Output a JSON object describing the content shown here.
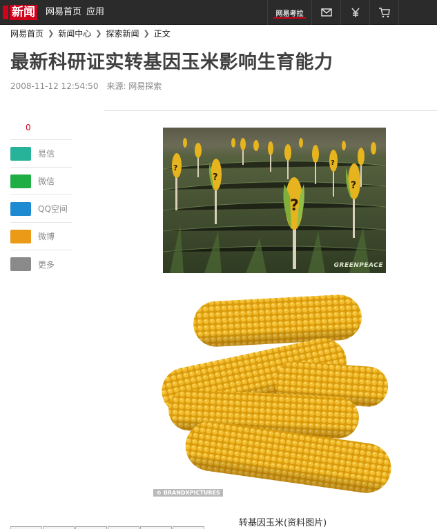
{
  "topbar": {
    "logo_text": "新闻",
    "nav": {
      "home": "网易首页",
      "apps": "应用"
    },
    "kaola": "网易考拉",
    "icons": [
      "mail-icon",
      "yen-icon",
      "cart-icon"
    ]
  },
  "breadcrumb": [
    "网易首页",
    "新闻中心",
    "探索新闻",
    "正文"
  ],
  "article": {
    "title": "最新科研证实转基因玉米影响生育能力",
    "date": "2008-11-12 12:54:50",
    "source": "来源: 网易探索"
  },
  "share": {
    "counter": "0",
    "items": [
      {
        "label": "易信",
        "color": "#27b399"
      },
      {
        "label": "微信",
        "color": "#1fae44"
      },
      {
        "label": "QQ空间",
        "color": "#1e8ad2"
      },
      {
        "label": "微博",
        "color": "#ea9a16"
      },
      {
        "label": "更多",
        "color": "#8a8a8a"
      }
    ]
  },
  "images": {
    "photo1_watermark": "GREENPEACE",
    "photo2_watermark": "© BRANDXPICTURES",
    "caption": "转基因玉米(资料图片)"
  },
  "colors": {
    "brand_red": "#d0021b",
    "topbar_bg": "#2b2b2b",
    "title_gray": "#404040"
  }
}
